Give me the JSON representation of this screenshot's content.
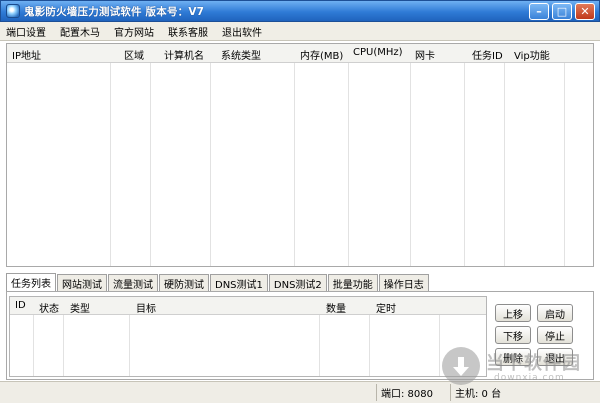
{
  "window": {
    "title": "鬼影防火墙压力测试软件 版本号：V7",
    "controls": {
      "minimize": "–",
      "maximize": "□",
      "close": "✕"
    }
  },
  "menu": [
    "端口设置",
    "配置木马",
    "官方网站",
    "联系客服",
    "退出软件"
  ],
  "main_grid": {
    "columns": [
      "IP地址",
      "区域",
      "计算机名",
      "系统类型",
      "内存(MB)",
      "CPU(MHz)",
      "网卡",
      "任务ID",
      "Vip功能"
    ],
    "rows": []
  },
  "tabs": [
    "任务列表",
    "网站测试",
    "流量测试",
    "硬防测试",
    "DNS测试1",
    "DNS测试2",
    "批量功能",
    "操作日志"
  ],
  "active_tab": "任务列表",
  "task_grid": {
    "columns": [
      "ID",
      "状态",
      "类型",
      "目标",
      "数量",
      "定时"
    ],
    "rows": []
  },
  "buttons": {
    "move_up": "上移",
    "start": "启动",
    "move_down": "下移",
    "stop": "停止",
    "delete": "删除",
    "exit": "退出"
  },
  "status": {
    "port": "端口: 8080",
    "hosts": "主机: 0 台"
  },
  "watermark": {
    "text": "当下软件园",
    "url": "downxia.com"
  },
  "icons": {
    "app": "app-logo-icon",
    "watermark": "download-arrow-icon"
  }
}
